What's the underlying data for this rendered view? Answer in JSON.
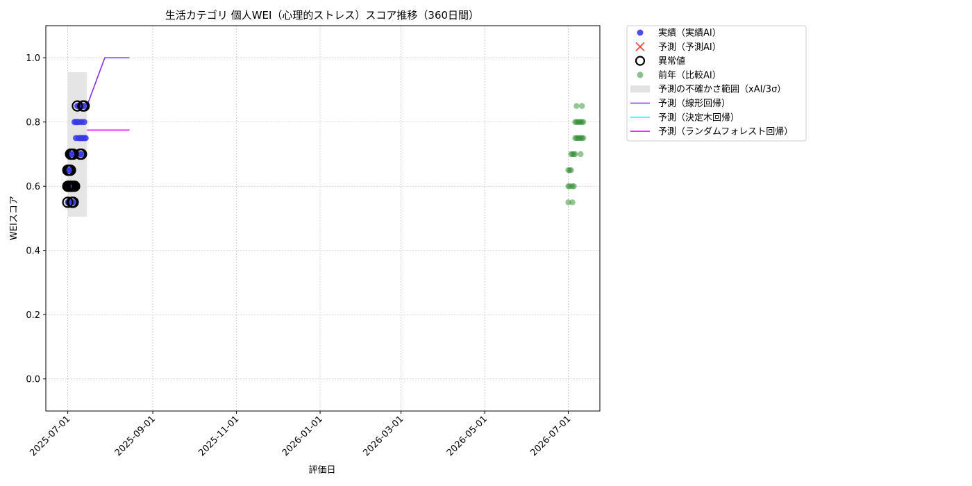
{
  "chart_data": {
    "type": "scatter",
    "title": "生活カテゴリ 個人WEI（心理的ストレス）スコア推移（360日間）",
    "xlabel": "評価日",
    "ylabel": "WEIスコア",
    "xlim": [
      "2025-06-15",
      "2026-07-24"
    ],
    "ylim": [
      -0.1,
      1.1
    ],
    "grid": true,
    "legend_placement": "outside-top-right",
    "x_ticks": [
      "2025-07-01",
      "2025-09-01",
      "2025-11-01",
      "2026-01-01",
      "2026-03-01",
      "2026-05-01",
      "2026-07-01"
    ],
    "y_ticks": [
      "0.0",
      "0.2",
      "0.4",
      "0.6",
      "0.8",
      "1.0"
    ],
    "legend": [
      {
        "label": "実績（実績AI）",
        "kind": "dot",
        "color": "#3a3ae6"
      },
      {
        "label": "予測（予測AI）",
        "kind": "cross",
        "color": "#ff4444"
      },
      {
        "label": "異常値",
        "kind": "ring",
        "color": "#000000"
      },
      {
        "label": "前年（比較AI）",
        "kind": "dot",
        "color": "#8fbf8f"
      },
      {
        "label": "予測の不確かさ範囲（xAI/3σ）",
        "kind": "band",
        "color": "#e2e2e2"
      },
      {
        "label": "予測（線形回帰）",
        "kind": "line",
        "color": "#8a2be2"
      },
      {
        "label": "予測（決定木回帰）",
        "kind": "line",
        "color": "#00ffff"
      },
      {
        "label": "予測（ランダムフォレスト回帰）",
        "kind": "line",
        "color": "#ff00ff"
      }
    ],
    "series": [
      {
        "name": "実績（実績AI）",
        "color": "#3a3ae6",
        "points": [
          [
            "2025-07-01",
            0.65
          ],
          [
            "2025-07-01",
            0.6
          ],
          [
            "2025-07-01",
            0.55
          ],
          [
            "2025-07-02",
            0.65
          ],
          [
            "2025-07-02",
            0.6
          ],
          [
            "2025-07-03",
            0.65
          ],
          [
            "2025-07-03",
            0.6
          ],
          [
            "2025-07-03",
            0.7
          ],
          [
            "2025-07-04",
            0.55
          ],
          [
            "2025-07-04",
            0.6
          ],
          [
            "2025-07-04",
            0.7
          ],
          [
            "2025-07-05",
            0.6
          ],
          [
            "2025-07-05",
            0.7
          ],
          [
            "2025-07-05",
            0.55
          ],
          [
            "2025-07-06",
            0.6
          ],
          [
            "2025-07-06",
            0.8
          ],
          [
            "2025-07-07",
            0.75
          ],
          [
            "2025-07-07",
            0.8
          ],
          [
            "2025-07-07",
            0.7
          ],
          [
            "2025-07-08",
            0.85
          ],
          [
            "2025-07-08",
            0.8
          ],
          [
            "2025-07-09",
            0.75
          ],
          [
            "2025-07-09",
            0.8
          ],
          [
            "2025-07-09",
            0.85
          ],
          [
            "2025-07-10",
            0.7
          ],
          [
            "2025-07-10",
            0.75
          ],
          [
            "2025-07-11",
            0.8
          ],
          [
            "2025-07-11",
            0.75
          ],
          [
            "2025-07-11",
            0.7
          ],
          [
            "2025-07-12",
            0.85
          ],
          [
            "2025-07-12",
            0.75
          ],
          [
            "2025-07-13",
            0.8
          ],
          [
            "2025-07-13",
            0.85
          ],
          [
            "2025-07-13",
            0.75
          ],
          [
            "2025-07-14",
            0.75
          ]
        ]
      },
      {
        "name": "異常値",
        "color": "#000000",
        "points": [
          [
            "2025-07-01",
            0.65
          ],
          [
            "2025-07-01",
            0.55
          ],
          [
            "2025-07-01",
            0.6
          ],
          [
            "2025-07-02",
            0.65
          ],
          [
            "2025-07-02",
            0.6
          ],
          [
            "2025-07-03",
            0.6
          ],
          [
            "2025-07-03",
            0.65
          ],
          [
            "2025-07-03",
            0.7
          ],
          [
            "2025-07-04",
            0.55
          ],
          [
            "2025-07-04",
            0.6
          ],
          [
            "2025-07-04",
            0.7
          ],
          [
            "2025-07-05",
            0.6
          ],
          [
            "2025-07-05",
            0.55
          ],
          [
            "2025-07-05",
            0.7
          ],
          [
            "2025-07-06",
            0.6
          ],
          [
            "2025-07-08",
            0.85
          ],
          [
            "2025-07-10",
            0.7
          ],
          [
            "2025-07-11",
            0.7
          ],
          [
            "2025-07-12",
            0.85
          ],
          [
            "2025-07-13",
            0.85
          ]
        ]
      },
      {
        "name": "前年（比較AI）",
        "color": "#2e8b2e",
        "points": [
          [
            "2026-07-01",
            0.55
          ],
          [
            "2026-07-01",
            0.6
          ],
          [
            "2026-07-01",
            0.65
          ],
          [
            "2026-07-02",
            0.6
          ],
          [
            "2026-07-02",
            0.65
          ],
          [
            "2026-07-03",
            0.7
          ],
          [
            "2026-07-03",
            0.65
          ],
          [
            "2026-07-04",
            0.6
          ],
          [
            "2026-07-04",
            0.7
          ],
          [
            "2026-07-04",
            0.55
          ],
          [
            "2026-07-05",
            0.6
          ],
          [
            "2026-07-05",
            0.7
          ],
          [
            "2026-07-06",
            0.75
          ],
          [
            "2026-07-06",
            0.8
          ],
          [
            "2026-07-06",
            0.7
          ],
          [
            "2026-07-07",
            0.8
          ],
          [
            "2026-07-07",
            0.75
          ],
          [
            "2026-07-07",
            0.85
          ],
          [
            "2026-07-08",
            0.8
          ],
          [
            "2026-07-08",
            0.75
          ],
          [
            "2026-07-09",
            0.75
          ],
          [
            "2026-07-09",
            0.8
          ],
          [
            "2026-07-10",
            0.7
          ],
          [
            "2026-07-10",
            0.8
          ],
          [
            "2026-07-10",
            0.75
          ],
          [
            "2026-07-11",
            0.85
          ],
          [
            "2026-07-11",
            0.8
          ],
          [
            "2026-07-11",
            0.75
          ],
          [
            "2026-07-12",
            0.75
          ],
          [
            "2026-07-12",
            0.8
          ]
        ]
      }
    ],
    "uncertainty_band": {
      "x_start": "2025-07-01",
      "x_end": "2025-07-15",
      "y_low": 0.505,
      "y_high": 0.955,
      "color": "#e2e2e2"
    },
    "prediction_lines": [
      {
        "name": "予測（線形回帰）",
        "color": "#8a2be2",
        "points": [
          [
            "2025-07-15",
            0.85
          ],
          [
            "2025-07-28",
            1.0
          ],
          [
            "2025-08-15",
            1.0
          ]
        ]
      },
      {
        "name": "予測（ランダムフォレスト回帰）",
        "color": "#ff00ff",
        "points": [
          [
            "2025-07-15",
            0.775
          ],
          [
            "2025-08-15",
            0.775
          ]
        ]
      }
    ]
  }
}
